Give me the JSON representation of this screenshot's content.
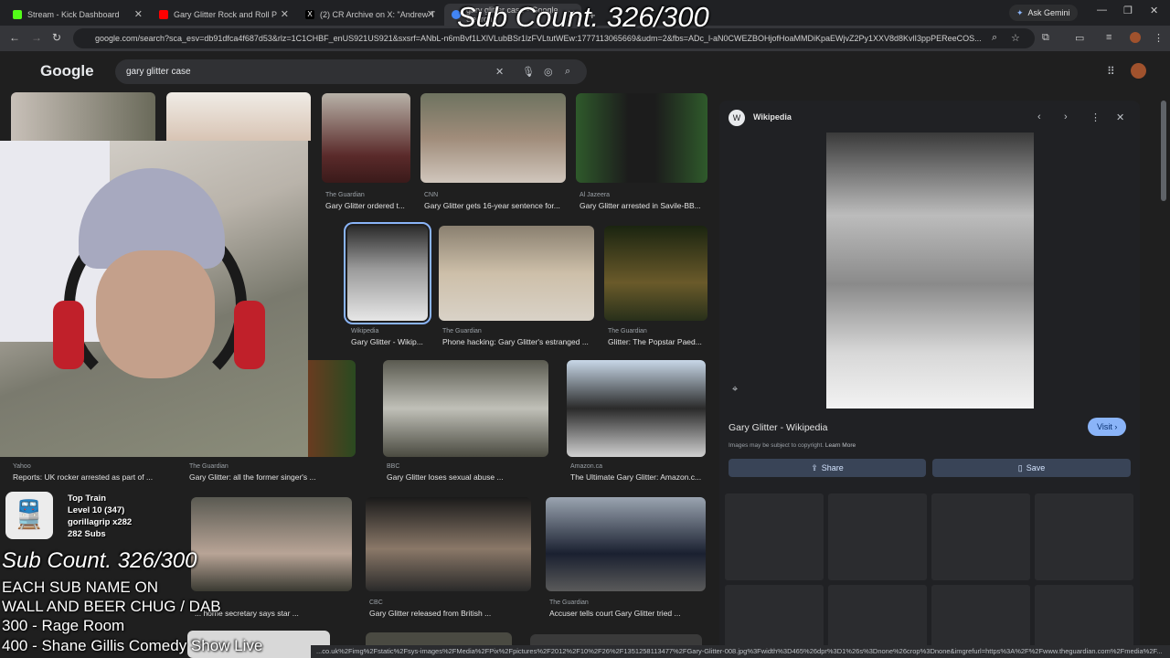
{
  "browser": {
    "tabs": [
      {
        "label": "Stream - Kick Dashboard",
        "color": "#53fc18"
      },
      {
        "label": "Gary Glitter Rock and Roll P",
        "color": "#ff0000"
      },
      {
        "label": "(2) CR Archive on X: \"Andrew T",
        "color": "#000000"
      },
      {
        "label": "gary glitter case - Google Search",
        "color": "#4285f4"
      }
    ],
    "gemini_label": "Ask Gemini",
    "url": "google.com/search?sca_esv=db91dfca4f687d53&rlz=1C1CHBF_enUS921US921&sxsrf=ANbL-n6mBvf1LXlVLubBSr1lzFVLtutWEw:1777113065669&udm=2&fbs=ADc_l-aN0CWEZBOHjofHoaMMDiKpaEWjvZ2Py1XXV8d8KvlI3ppPEReeCOS..."
  },
  "google": {
    "logo": "Google",
    "query": "gary glitter case"
  },
  "results": [
    {
      "source": "The Guardian",
      "caption": "Gary Glitter ordered t..."
    },
    {
      "source": "CNN",
      "caption": "Gary Glitter gets 16-year sentence for..."
    },
    {
      "source": "Al Jazeera",
      "caption": "Gary Glitter arrested in Savile-BB..."
    },
    {
      "source": "Wikipedia",
      "caption": "Gary Glitter - Wikip..."
    },
    {
      "source": "The Guardian",
      "caption": "Phone hacking: Gary Glitter's estranged ..."
    },
    {
      "source": "The Guardian",
      "caption": "Glitter: The Popstar Paed..."
    },
    {
      "source": "Yahoo",
      "caption": "Reports: UK rocker arrested as part of ..."
    },
    {
      "source": "The Guardian",
      "caption": "Gary Glitter: all the former singer's ..."
    },
    {
      "source": "BBC",
      "caption": "Gary Glitter loses sexual abuse ..."
    },
    {
      "source": "Amazon.ca",
      "caption": "The Ultimate Gary Glitter: Amazon.c..."
    },
    {
      "source": "",
      "caption": "... home secretary says star ..."
    },
    {
      "source": "CBC",
      "caption": "Gary Glitter released from British ..."
    },
    {
      "source": "The Guardian",
      "caption": "Accuser tells court Gary Glitter tried ..."
    }
  ],
  "panel": {
    "site": "Wikipedia",
    "title": "Gary Glitter - Wikipedia",
    "visit_label": "Visit",
    "copyright": "Images may be subject to copyright.",
    "learn_more": "Learn More",
    "share_label": "Share",
    "save_label": "Save"
  },
  "overlay": {
    "sub_count": "Sub Count. 326/300",
    "top_train": {
      "title": "Top Train",
      "level": "Level 10 (347)",
      "user": "gorillagrip x282",
      "subs": "282 Subs"
    },
    "lines": [
      "EACH SUB NAME ON",
      "WALL AND BEER CHUG / DAB",
      "300 - Rage Room",
      "400 - Shane Gillis Comedy Show Live"
    ]
  },
  "status_url": "...co.uk%2Fimg%2Fstatic%2Fsys-images%2FMedia%2FPix%2Fpictures%2F2012%2F10%2F26%2F1351258113477%2FGary-Glitter-008.jpg%3Fwidth%3D465%26dpr%3D1%26s%3Dnone%26crop%3Dnone&imgrefurl=https%3A%2F%2Fwww.theguardian.com%2Fmedia%2F..."
}
